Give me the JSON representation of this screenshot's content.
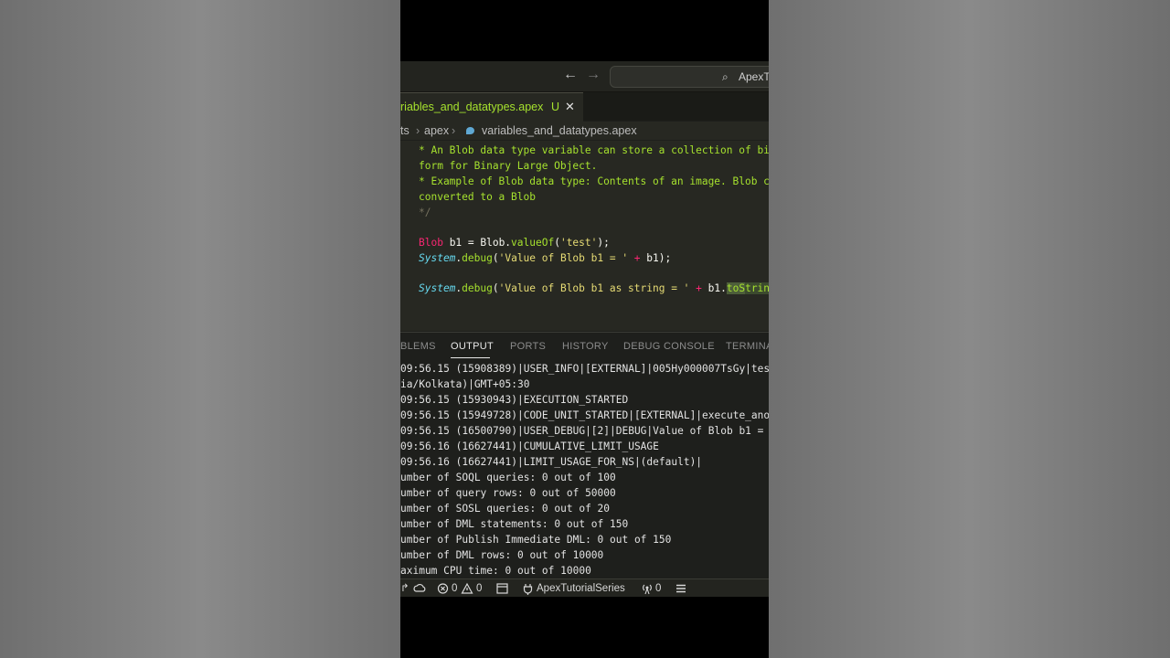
{
  "titlebar": {
    "back_icon": "arrow-left-icon",
    "forward_icon": "arrow-right-icon",
    "command_center_label": "ApexTu"
  },
  "tab": {
    "name": "riables_and_datatypes.apex",
    "status": "U",
    "close": "✕"
  },
  "breadcrumb": {
    "items": [
      "ts",
      "apex",
      "variables_and_datatypes.apex"
    ],
    "separator": "›"
  },
  "editor": {
    "comment_lines": [
      "* An Blob data type variable can store a collection of bi",
      "form for Binary Large Object.",
      "* Example of Blob data type: Contents of an image. Blob c",
      "converted to a Blob",
      "*/"
    ],
    "line1": {
      "type": "Blob",
      "rest": " b1 = Blob.",
      "fn": "valueOf",
      "args_open": "(",
      "str": "'test'",
      "end": ");"
    },
    "line2": {
      "cls": "System",
      "dot": ".",
      "fn": "debug",
      "open": "(",
      "str": "'Value of Blob b1 = '",
      "op": " + ",
      "var": "b1",
      "end": ");"
    },
    "line3": {
      "cls": "System",
      "dot": ".",
      "fn": "debug",
      "open": "(",
      "str": "'Value of Blob b1 as string = '",
      "op": " + ",
      "var": "b1.",
      "sel": "toS",
      "cursor_rest": "trin"
    }
  },
  "panel": {
    "tabs": [
      "BLEMS",
      "OUTPUT",
      "PORTS",
      "HISTORY",
      "DEBUG CONSOLE",
      "TERMINA"
    ],
    "active_tab": "OUTPUT",
    "output_lines": [
      "09:56.15 (15908389)|USER_INFO|[EXTERNAL]|005Hy000007TsGy|tes",
      "ia/Kolkata)|GMT+05:30",
      "09:56.15 (15930943)|EXECUTION_STARTED",
      "09:56.15 (15949728)|CODE_UNIT_STARTED|[EXTERNAL]|execute_ano",
      "09:56.15 (16500790)|USER_DEBUG|[2]|DEBUG|Value of Blob b1 =",
      "09:56.16 (16627441)|CUMULATIVE_LIMIT_USAGE",
      "09:56.16 (16627441)|LIMIT_USAGE_FOR_NS|(default)|",
      "umber of SOQL queries: 0 out of 100",
      "umber of query rows: 0 out of 50000",
      "umber of SOSL queries: 0 out of 20",
      "umber of DML statements: 0 out of 150",
      "umber of Publish Immediate DML: 0 out of 150",
      "umber of DML rows: 0 out of 10000",
      "aximum CPU time: 0 out of 10000"
    ]
  },
  "statusbar": {
    "branch_glyph": "↱",
    "sync_icon": "cloud-sync-icon",
    "errors": "0",
    "warnings": "0",
    "project": "ApexTutorialSeries",
    "ports": "0"
  }
}
